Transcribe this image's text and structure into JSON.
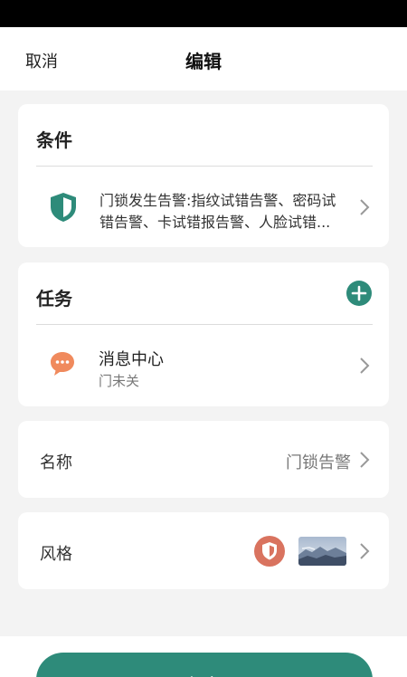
{
  "header": {
    "cancel_label": "取消",
    "title": "编辑"
  },
  "condition": {
    "title": "条件",
    "icon": "shield-icon",
    "text_line1": "门锁发生告警:指纹试错告警、密码试",
    "text_line2": "错告警、卡试错报告警、人脸试错..."
  },
  "task": {
    "title": "任务",
    "add_icon": "plus-circle-icon",
    "item": {
      "icon": "message-bubble-icon",
      "title": "消息中心",
      "subtitle": "门未关"
    }
  },
  "name_row": {
    "label": "名称",
    "value": "门锁告警"
  },
  "style_row": {
    "label": "风格",
    "badge_icon": "shield-badge-icon",
    "thumbnail": "landscape-thumbnail"
  },
  "footer": {
    "save_label": "保存"
  },
  "colors": {
    "accent": "#2e8b7a",
    "orange": "#f08a5d",
    "badge": "#d9735f",
    "background": "#f3f3f3"
  }
}
